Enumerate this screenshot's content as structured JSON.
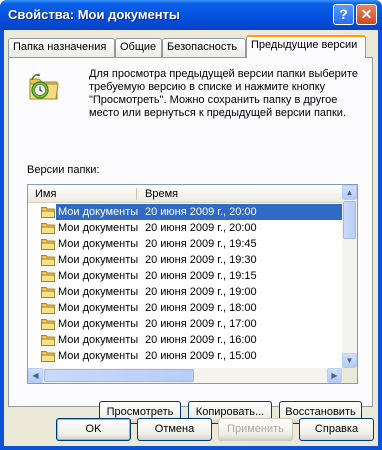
{
  "window": {
    "title": "Свойства: Мои документы",
    "help_glyph": "?",
    "close_glyph": "✕"
  },
  "tabs": [
    {
      "label": "Папка назначения",
      "active": false
    },
    {
      "label": "Общие",
      "active": false
    },
    {
      "label": "Безопасность",
      "active": false
    },
    {
      "label": "Предыдущие версии",
      "active": true
    }
  ],
  "panel": {
    "icon": "folder-clock-icon",
    "description": "Для просмотра предыдущей версии папки выберите требуемую версию в списке и нажмите кнопку \"Просмотреть\". Можно сохранить папку в другое место или вернуться к предыдущей версии папки.",
    "versions_label": "Версии папки:",
    "columns": {
      "name": "Имя",
      "time": "Время"
    },
    "rows": [
      {
        "name": "Мои документы",
        "time": "20 июня 2009 г., 20:00",
        "selected": true
      },
      {
        "name": "Мои документы",
        "time": "20 июня 2009 г., 20:00",
        "selected": false
      },
      {
        "name": "Мои документы",
        "time": "20 июня 2009 г., 19:45",
        "selected": false
      },
      {
        "name": "Мои документы",
        "time": "20 июня 2009 г., 19:30",
        "selected": false
      },
      {
        "name": "Мои документы",
        "time": "20 июня 2009 г., 19:15",
        "selected": false
      },
      {
        "name": "Мои документы",
        "time": "20 июня 2009 г., 19:00",
        "selected": false
      },
      {
        "name": "Мои документы",
        "time": "20 июня 2009 г., 18:00",
        "selected": false
      },
      {
        "name": "Мои документы",
        "time": "20 июня 2009 г., 17:00",
        "selected": false
      },
      {
        "name": "Мои документы",
        "time": "20 июня 2009 г., 16:00",
        "selected": false
      },
      {
        "name": "Мои документы",
        "time": "20 июня 2009 г., 15:00",
        "selected": false
      }
    ],
    "buttons": {
      "view": "Просмотреть",
      "copy": "Копировать...",
      "restore": "Восстановить"
    }
  },
  "footer": {
    "ok": "OK",
    "cancel": "Отмена",
    "apply": "Применить",
    "help": "Справка"
  },
  "colors": {
    "titlebar": "#0553e0",
    "selection": "#316ac5",
    "active_tab_accent": "#ff9f00",
    "dialog_bg": "#ece9d8"
  }
}
